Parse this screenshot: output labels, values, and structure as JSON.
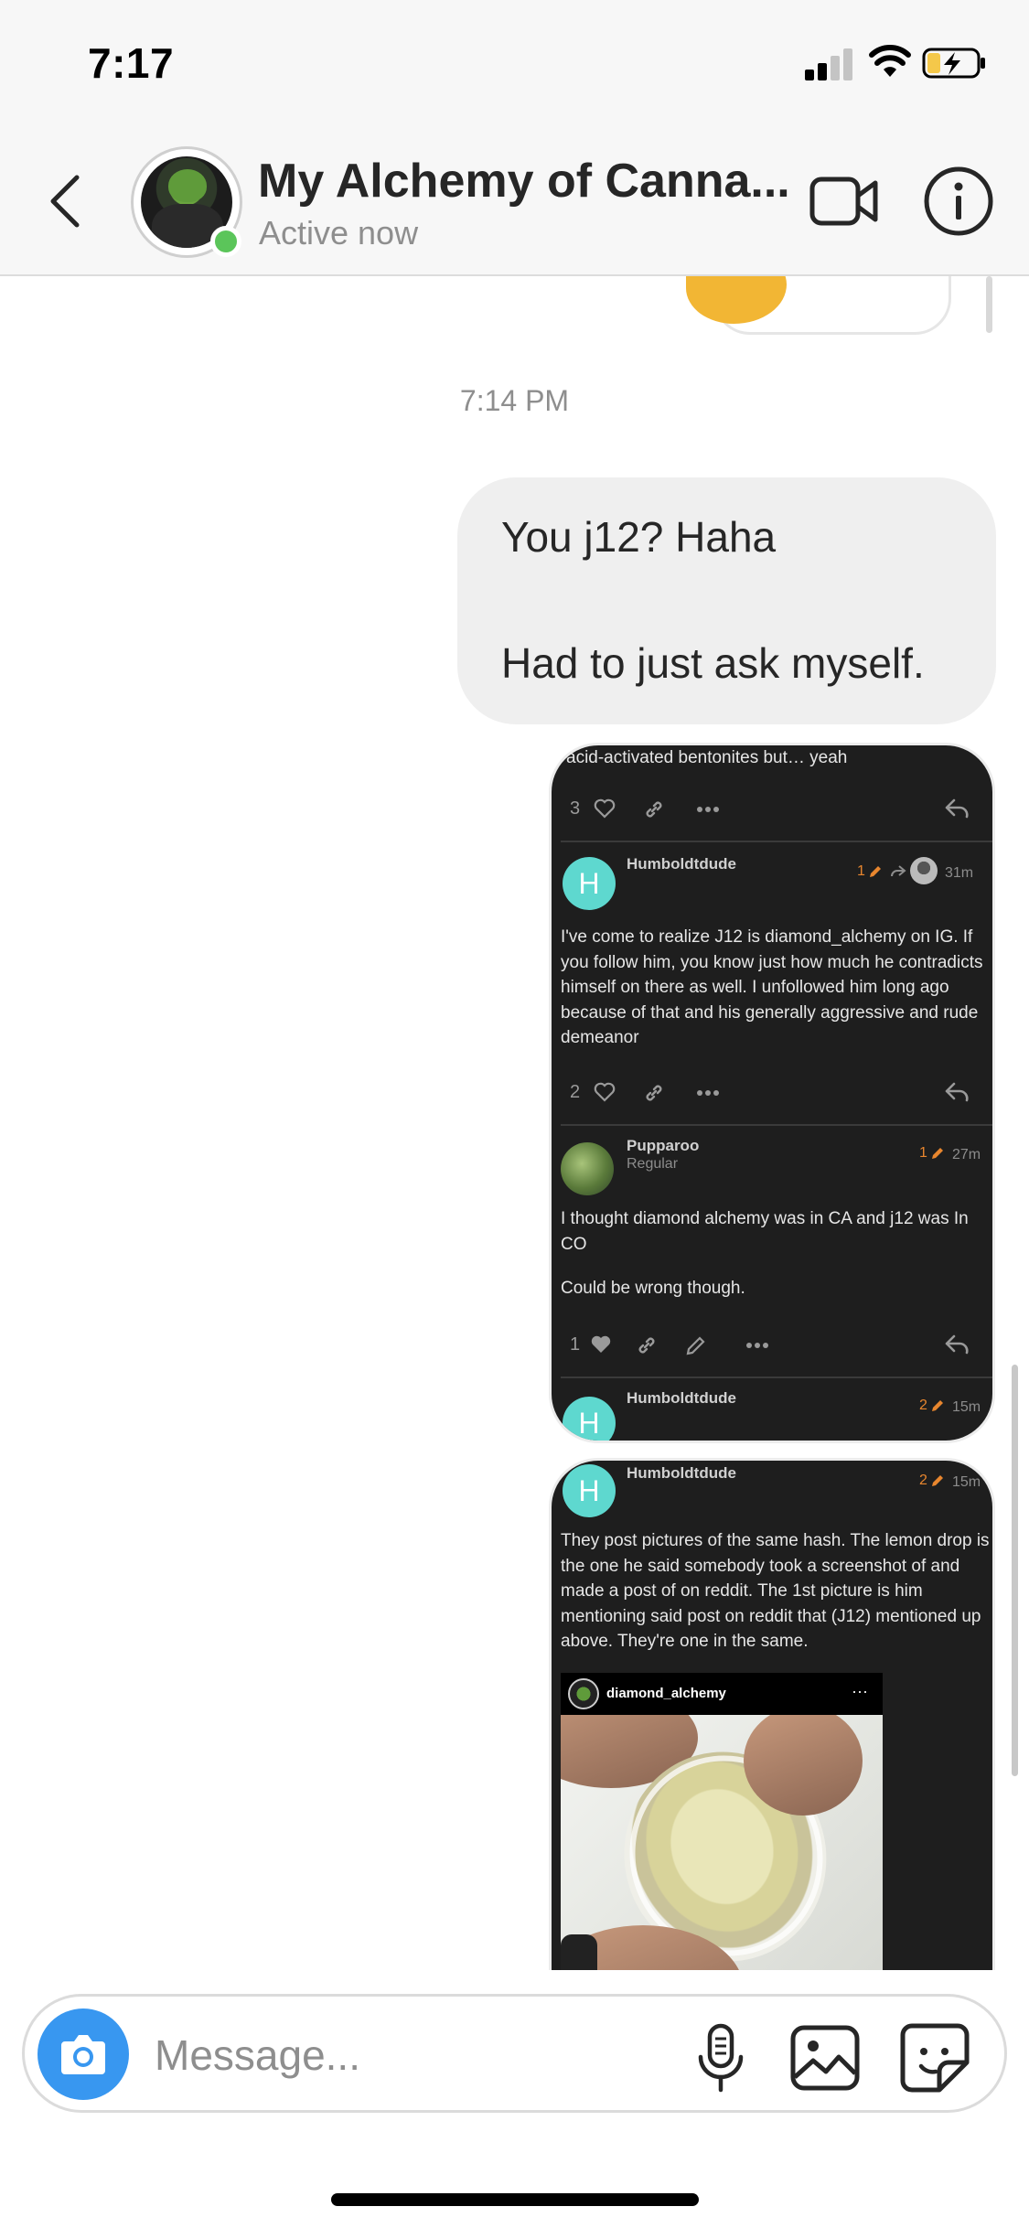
{
  "status_bar": {
    "time": "7:17",
    "icons": [
      "cellular-signal-icon",
      "wifi-icon",
      "battery-charging-icon"
    ]
  },
  "header": {
    "back_icon": "chevron-left-icon",
    "chat_name": "My Alchemy of Canna...",
    "status": "Active now",
    "online_color": "#5bc55a",
    "video_icon": "video-camera-icon",
    "info_icon": "info-icon"
  },
  "thread": {
    "timestamp": "7:14 PM",
    "sent_message": {
      "line1": "You j12? Haha",
      "line2": "Had to just ask myself."
    },
    "screenshot1": {
      "top_text": "acid-activated bentonites but… yeah",
      "top_likes": "3",
      "post1": {
        "username": "Humboldtdude",
        "edits": "1",
        "time": "31m",
        "body": "I've come to realize J12 is diamond_alchemy on IG. If you follow him, you know just how much he contradicts himself on there as well. I unfollowed him long ago because of that and his generally aggressive and rude demeanor",
        "likes": "2",
        "avatar_letter": "H"
      },
      "post2": {
        "username": "Pupparoo",
        "role": "Regular",
        "edits": "1",
        "time": "27m",
        "body1": "I thought diamond alchemy was in CA and j12 was In CO",
        "body2": "Could be wrong though.",
        "likes": "1"
      },
      "post3": {
        "username": "Humboldtdude",
        "edits": "2",
        "time": "15m",
        "avatar_letter": "H"
      }
    },
    "screenshot2": {
      "username": "Humboldtdude",
      "edits": "2",
      "time": "15m",
      "avatar_letter": "H",
      "body": "They post pictures of the same hash. The lemon drop is the one he said somebody took a screenshot of and made a post of on reddit. The 1st picture is him mentioning said post on reddit that (J12) mentioned up above. They're one in the same.",
      "embed_user": "diamond_alchemy",
      "embed_more": "···"
    }
  },
  "composer": {
    "placeholder": "Message...",
    "camera_icon": "camera-icon",
    "mic_icon": "microphone-icon",
    "gallery_icon": "gallery-icon",
    "sticker_icon": "sticker-icon",
    "accent": "#3897f0"
  },
  "colors": {
    "bubble_gray": "#efefef",
    "dark_card": "#1e1e1e",
    "avatar_teal": "#5ed8cf",
    "edit_orange": "#e8862e"
  }
}
